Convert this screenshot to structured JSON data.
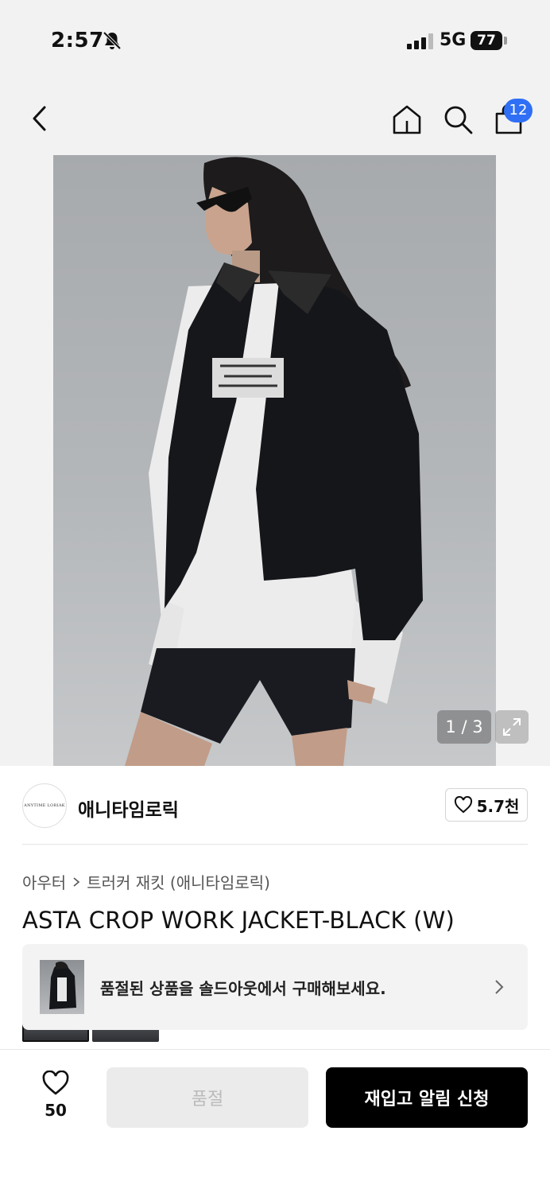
{
  "status_bar": {
    "time": "2:57",
    "network": "5G",
    "battery": "77"
  },
  "nav": {
    "cart_count": "12"
  },
  "gallery": {
    "counter": "1 / 3"
  },
  "brand": {
    "logo_text": "ANYTIME LORIAK",
    "name": "애니타임로릭",
    "likes": "5.7천"
  },
  "breadcrumb": {
    "category": "아우터",
    "subcategory": "트러커 재킷 (애니타임로릭)"
  },
  "product": {
    "title": "ASTA CROP WORK JACKET-BLACK (W)"
  },
  "soldout_banner": {
    "text": "품절된 상품을 솔드아웃에서 구매해보세요."
  },
  "bottom_bar": {
    "wish_count": "50",
    "soldout_label": "품절",
    "restock_label": "재입고 알림 신청"
  }
}
